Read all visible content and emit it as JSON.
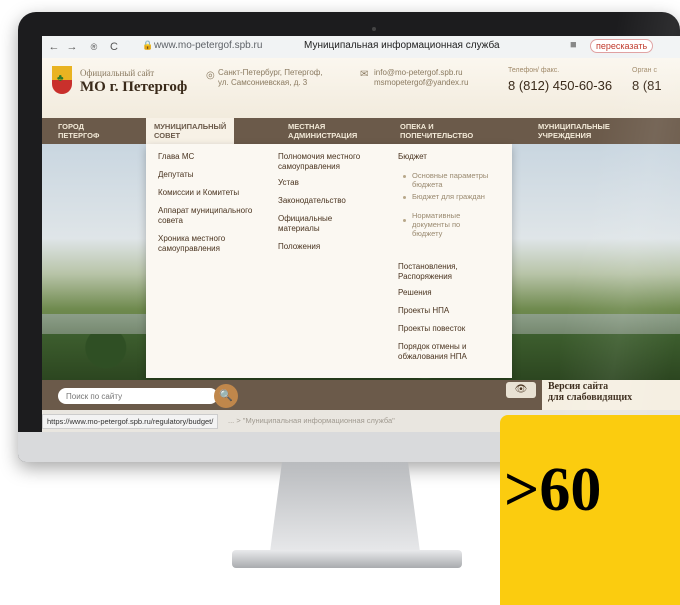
{
  "browser": {
    "back_icon": "←",
    "forward_icon": "→",
    "reader_icon": "®",
    "reload_icon": "C",
    "lock_icon": "🔒",
    "url": "www.mo-petergof.spb.ru",
    "tab_title": "Муниципальная информационная служба",
    "bookmark_icon": "■",
    "retell_label": "пересказать"
  },
  "header": {
    "official_label": "Официальный сайт",
    "site_name": "МО г. Петергоф",
    "address_line1": "Санкт-Петербург, Петергоф,",
    "address_line2": "ул. Самсониевская, д. 3",
    "email1": "info@mo-petergof.spb.ru",
    "email2": "msmopetergof@yandex.ru",
    "phone_label": "Телефон/ факс.",
    "phone": "8 (812) 450-60-36",
    "phone2_label": "Орган с",
    "phone2": "8 (81"
  },
  "nav": {
    "items": [
      {
        "line1": "ГОРОД",
        "line2": "ПЕТЕРГОФ"
      },
      {
        "line1": "МУНИЦИПАЛЬНЫЙ",
        "line2": "СОВЕТ"
      },
      {
        "line1": "МЕСТНАЯ",
        "line2": "АДМИНИСТРАЦИЯ"
      },
      {
        "line1": "ОПЕКА И",
        "line2": "ПОПЕЧИТЕЛЬСТВО"
      },
      {
        "line1": "МУНИЦИПАЛЬНЫЕ",
        "line2": "УЧРЕЖДЕНИЯ"
      }
    ]
  },
  "dropdown": {
    "col1": [
      "Глава МС",
      "Депутаты",
      "Комиссии и Комитеты",
      "Аппарат муниципального совета",
      "Хроника местного самоуправления"
    ],
    "col2": [
      "Полномочия местного самоуправления",
      "Устав",
      "Законодательство",
      "Официальные материалы",
      "Положения"
    ],
    "col3": {
      "budget": "Бюджет",
      "budget_sub": [
        "Основные параметры бюджета",
        "Бюджет для граждан",
        "Нормативные документы по бюджету"
      ],
      "items": [
        "Постановления, Распоряжения",
        "Решения",
        "Проекты НПА",
        "Проекты повесток",
        "Порядок отмены и обжалования НПА"
      ]
    }
  },
  "footer": {
    "search_placeholder": "Поиск по сайту",
    "search_icon": "🔍",
    "eye_icon": "👁",
    "accessibility_line1": "Версия сайта",
    "accessibility_line2": "для слабовидящих"
  },
  "status": {
    "hover_url": "https://www.mo-petergof.spb.ru/regulatory/budget/",
    "crumb": "...  >  \"Муниципальная информационная служба\""
  },
  "promo": {
    "text": ">60"
  }
}
